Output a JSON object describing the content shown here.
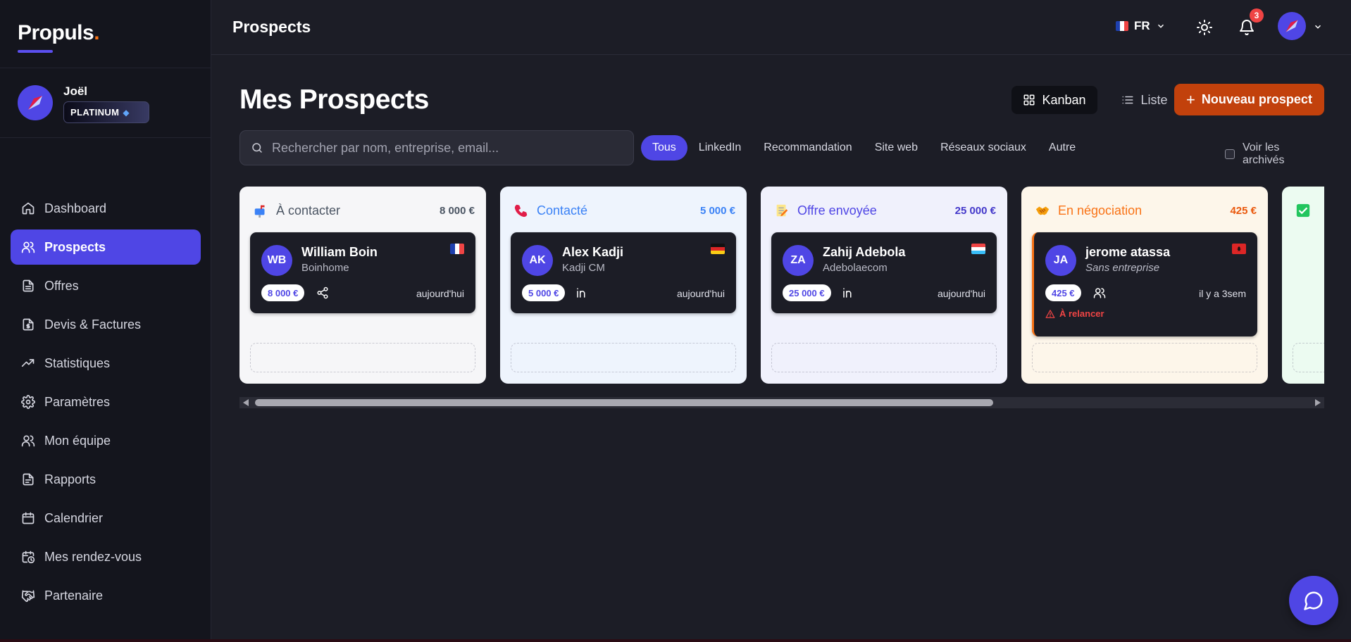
{
  "sidebar": {
    "logo_text": "Propuls",
    "logo_dot": ".",
    "user": {
      "name": "Joël",
      "badge": "PLATINUM"
    },
    "items": [
      {
        "label": "Dashboard",
        "icon": "home-icon"
      },
      {
        "label": "Prospects",
        "icon": "users-icon",
        "active": true
      },
      {
        "label": "Offres",
        "icon": "document-icon"
      },
      {
        "label": "Devis & Factures",
        "icon": "invoice-icon"
      },
      {
        "label": "Statistiques",
        "icon": "trending-up-icon"
      },
      {
        "label": "Paramètres",
        "icon": "gear-icon"
      },
      {
        "label": "Mon équipe",
        "icon": "team-icon"
      },
      {
        "label": "Rapports",
        "icon": "report-icon"
      },
      {
        "label": "Calendrier",
        "icon": "calendar-icon"
      },
      {
        "label": "Mes rendez-vous",
        "icon": "calendar-clock-icon"
      },
      {
        "label": "Partenaire",
        "icon": "handshake-icon"
      }
    ]
  },
  "topbar": {
    "title": "Prospects",
    "language": "FR",
    "notifications_count": "3"
  },
  "page": {
    "title": "Mes Prospects",
    "view_kanban": "Kanban",
    "view_list": "Liste",
    "new_button": "Nouveau prospect",
    "search_placeholder": "Rechercher par nom, entreprise, email...",
    "filters": [
      "Tous",
      "LinkedIn",
      "Recommandation",
      "Site web",
      "Réseaux sociaux",
      "Autre"
    ],
    "active_filter": "Tous",
    "show_archived": "Voir les archivés"
  },
  "columns": [
    {
      "title": "À contacter",
      "total": "8 000 €",
      "icon": "mailbox-icon",
      "bg": "#f6f6f8",
      "title_color": "#4b5563",
      "total_color": "#4b5563",
      "cards": [
        {
          "initials": "WB",
          "name": "William Boin",
          "company": "Boinhome",
          "amount": "8 000 €",
          "source_icon": "share-icon",
          "date": "aujourd'hui",
          "flag": "fr"
        }
      ]
    },
    {
      "title": "Contacté",
      "total": "5 000 €",
      "icon": "phone-icon",
      "bg": "#eef4fd",
      "title_color": "#3b82f6",
      "total_color": "#3b82f6",
      "cards": [
        {
          "initials": "AK",
          "name": "Alex Kadji",
          "company": "Kadji CM",
          "amount": "5 000 €",
          "source_icon": "linkedin-icon",
          "date": "aujourd'hui",
          "flag": "de"
        }
      ]
    },
    {
      "title": "Offre envoyée",
      "total": "25 000 €",
      "icon": "memo-icon",
      "bg": "#f0f1fc",
      "title_color": "#4f46e5",
      "total_color": "#4338ca",
      "cards": [
        {
          "initials": "ZA",
          "name": "Zahij Adebola",
          "company": "Adebolaecom",
          "amount": "25 000 €",
          "source_icon": "linkedin-icon",
          "date": "aujourd'hui",
          "flag": "lu"
        }
      ]
    },
    {
      "title": "En négociation",
      "total": "425 €",
      "icon": "handshake-emoji-icon",
      "bg": "#fdf6ea",
      "title_color": "#f97316",
      "total_color": "#ea580c",
      "cards": [
        {
          "initials": "JA",
          "name": "jerome atassa",
          "company": "Sans entreprise",
          "amount": "425 €",
          "source_icon": "referral-icon",
          "date": "il y a 3sem",
          "flag": "al",
          "relance": "À relancer"
        }
      ]
    }
  ]
}
